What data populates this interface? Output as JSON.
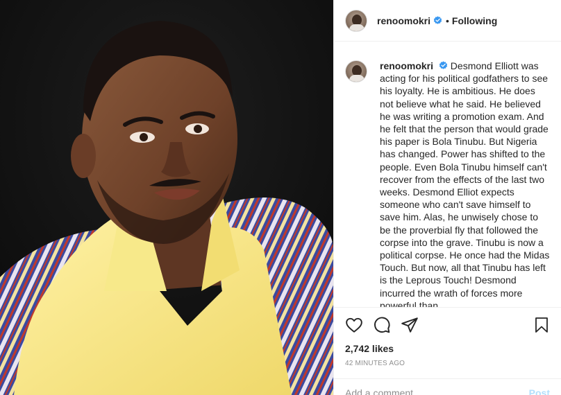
{
  "header": {
    "username": "renoomokri",
    "separator": "•",
    "follow_status": "Following"
  },
  "caption": {
    "username": "renoomokri",
    "text": "Desmond Elliott was acting for his political godfathers to see his loyalty. He is ambitious. He does not believe what he said. He believed he was writing a promotion exam. And he felt that the person that would grade his paper is Bola Tinubu. But Nigeria has changed. Power has shifted to the people. Even Bola Tinubu himself can't recover from the effects of the last two weeks. Desmond Elliot expects someone who can't save himself to save him. Alas, he unwisely chose to be the proverbial fly that followed the corpse into the grave. Tinubu is now a political corpse. He once had the Midas Touch. But now, all that Tinubu has left is the Leprous Touch! Desmond incurred the wrath of forces more powerful than"
  },
  "post": {
    "likes": "2,742 likes",
    "time": "42 minutes ago"
  },
  "comment": {
    "placeholder": "Add a comment...",
    "post_label": "Post"
  },
  "icons": [
    "heart-icon",
    "comment-icon",
    "share-icon",
    "bookmark-icon",
    "verified-badge-icon"
  ],
  "colors": {
    "verified": "#3897f0",
    "post_button": "#b2dffc",
    "muted": "#8e8e8e"
  }
}
